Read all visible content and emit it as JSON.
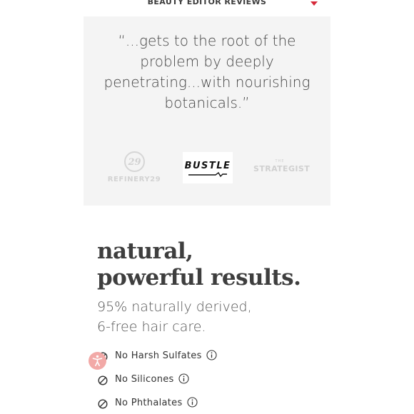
{
  "reviews": {
    "header_title": "BEAUTY EDITOR REVIEWS",
    "quote_lines": [
      "“...gets to the root of the",
      "problem by deeply",
      "penetrating...with nourishing",
      "botanicals.”"
    ],
    "logos": {
      "refinery29_mark": "29",
      "refinery29_text": "REFINERY29",
      "bustle_text": "BUSTLE",
      "strategist_small": "THE",
      "strategist_text": "STRATEGIST"
    }
  },
  "results": {
    "headline_line1": "natural,",
    "headline_line2": "powerful results.",
    "subhead_line1": "95% naturally derived,",
    "subhead_line2": "6-free hair care.",
    "features": [
      {
        "label": "No Harsh Sulfates"
      },
      {
        "label": "No Silicones"
      },
      {
        "label": "No Phthalates"
      }
    ]
  },
  "colors": {
    "accent": "#d6293a",
    "panel_bg": "#f4f4f4",
    "accessibility_button": "#f2a9a7"
  },
  "icons": {
    "header_toggle": "caret-down-icon",
    "feature_prefix": "prohibited-icon",
    "feature_suffix": "info-icon",
    "floating": "accessibility-icon"
  }
}
